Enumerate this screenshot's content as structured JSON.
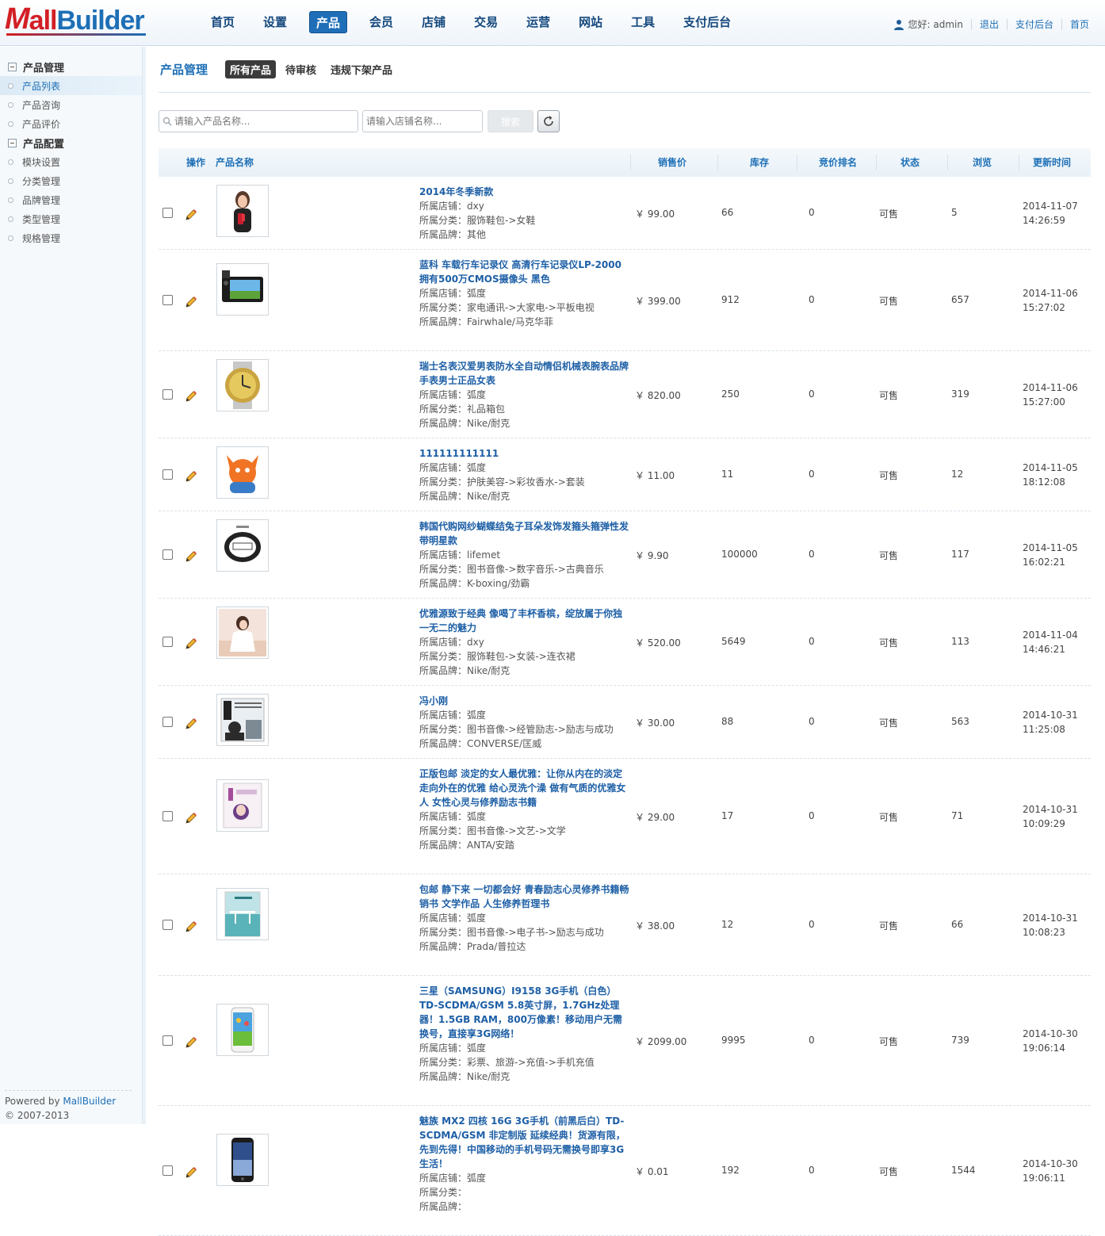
{
  "header": {
    "logo_m": "M",
    "logo_all": "all",
    "logo_builder": "Builder",
    "nav": [
      "首页",
      "设置",
      "产品",
      "会员",
      "店铺",
      "交易",
      "运营",
      "网站",
      "工具",
      "支付后台"
    ],
    "active_nav": 2,
    "greeting": "您好: admin",
    "logout": "退出",
    "pay_backend": "支付后台",
    "home": "首页"
  },
  "sidebar": {
    "groups": [
      {
        "title": "产品管理",
        "items": [
          "产品列表",
          "产品咨询",
          "产品评价"
        ]
      },
      {
        "title": "产品配置",
        "items": [
          "模块设置",
          "分类管理",
          "品牌管理",
          "类型管理",
          "规格管理"
        ]
      }
    ],
    "active_item": "产品列表",
    "powered_prefix": "Powered by ",
    "powered_link": "MallBuilder",
    "copyright": "© 2007-2013"
  },
  "main": {
    "title": "产品管理",
    "tabs": [
      "所有产品",
      "待审核",
      "违规下架产品"
    ],
    "active_tab": 0,
    "search": {
      "product_placeholder": "请输入产品名称...",
      "shop_placeholder": "请输入店铺名称...",
      "search_label": "搜索"
    },
    "columns": [
      "操作",
      "产品名称",
      "销售价",
      "库存",
      "竞价排名",
      "状态",
      "浏览",
      "更新时间"
    ],
    "labels": {
      "shop": "所属店铺：",
      "category": "所属分类：",
      "brand": "所属品牌："
    },
    "products": [
      {
        "name": "2014年冬季新款",
        "shop": "dxy",
        "category": "服饰鞋包->女鞋",
        "brand": "其他",
        "price": "￥ 99.00",
        "stock": "66",
        "rank": "0",
        "status": "可售",
        "views": "5",
        "date": "2014-11-07",
        "time": "14:26:59",
        "thumb": "woman-red"
      },
      {
        "name": "蓝科 车载行车记录仪 高清行车记录仪LP-2000 拥有500万CMOS摄像头 黑色",
        "shop": "弧度",
        "category": "家电通讯->大家电->平板电视",
        "brand": "Fairwhale/马克华菲",
        "price": "￥ 399.00",
        "stock": "912",
        "rank": "0",
        "status": "可售",
        "views": "657",
        "date": "2014-11-06",
        "time": "15:27:02",
        "thumb": "dashcam"
      },
      {
        "name": "瑞士名表汉爱男表防水全自动情侣机械表腕表品牌手表男士正品女表",
        "shop": "弧度",
        "category": "礼品箱包",
        "brand": "Nike/耐克",
        "price": "￥ 820.00",
        "stock": "250",
        "rank": "0",
        "status": "可售",
        "views": "319",
        "date": "2014-11-06",
        "time": "15:27:00",
        "thumb": "watch"
      },
      {
        "name": "111111111111",
        "shop": "弧度",
        "category": "护肤美容->彩妆香水->套装",
        "brand": "Nike/耐克",
        "price": "￥ 11.00",
        "stock": "11",
        "rank": "0",
        "status": "可售",
        "views": "12",
        "date": "2014-11-05",
        "time": "18:12:08",
        "thumb": "mascot"
      },
      {
        "name": "韩国代购网纱蝴蝶结兔子耳朵发饰发箍头箍弹性发带明星款",
        "shop": "lifemet",
        "category": "图书音像->数字音乐->古典音乐",
        "brand": "K-boxing/劲霸",
        "price": "￥ 9.90",
        "stock": "100000",
        "rank": "0",
        "status": "可售",
        "views": "117",
        "date": "2014-11-05",
        "time": "16:02:21",
        "thumb": "bracelet"
      },
      {
        "name": "优雅源致于经典 像喝了丰杯香槟，绽放属于你独一无二的魅力",
        "shop": "dxy",
        "category": "服饰鞋包->女装->连衣裙",
        "brand": "Nike/耐克",
        "price": "￥ 520.00",
        "stock": "5649",
        "rank": "0",
        "status": "可售",
        "views": "113",
        "date": "2014-11-04",
        "time": "14:46:21",
        "thumb": "woman-white"
      },
      {
        "name": "冯小刚",
        "shop": "弧度",
        "category": "图书音像->经管励志->励志与成功",
        "brand": "CONVERSE/匡威",
        "price": "￥ 30.00",
        "stock": "88",
        "rank": "0",
        "status": "可售",
        "views": "563",
        "date": "2014-10-31",
        "time": "11:25:08",
        "thumb": "book-portrait"
      },
      {
        "name": "正版包邮 淡定的女人最优雅：让你从内在的淡定走向外在的优雅 给心灵洗个澡 做有气质的优雅女人 女性心灵与修养励志书籍",
        "shop": "弧度",
        "category": "图书音像->文艺->文学",
        "brand": "ANTA/安踏",
        "price": "￥ 29.00",
        "stock": "17",
        "rank": "0",
        "status": "可售",
        "views": "71",
        "date": "2014-10-31",
        "time": "10:09:29",
        "thumb": "book-purple"
      },
      {
        "name": "包邮 静下来 一切都会好 青春励志心灵修养书籍畅销书 文学作品 人生修养哲理书",
        "shop": "弧度",
        "category": "图书音像->电子书->励志与成功",
        "brand": "Prada/普拉达",
        "price": "￥ 38.00",
        "stock": "12",
        "rank": "0",
        "status": "可售",
        "views": "66",
        "date": "2014-10-31",
        "time": "10:08:23",
        "thumb": "book-teal"
      },
      {
        "name": "三星（SAMSUNG）I9158 3G手机（白色） TD-SCDMA/GSM 5.8英寸屏，1.7GHz处理器！1.5GB RAM，800万像素！移动用户无需换号，直接享3G网络！",
        "shop": "弧度",
        "category": "彩票、旅游->充值->手机充值",
        "brand": "Nike/耐克",
        "price": "￥ 2099.00",
        "stock": "9995",
        "rank": "0",
        "status": "可售",
        "views": "739",
        "date": "2014-10-30",
        "time": "19:06:14",
        "thumb": "phone-white"
      },
      {
        "name": "魅族 MX2 四核 16G 3G手机（前黑后白）TD-SCDMA/GSM 非定制版 延续经典！货源有限，先到先得！中国移动的手机号码无需换号即享3G生活！",
        "shop": "弧度",
        "category": "",
        "brand": "",
        "price": "￥ 0.01",
        "stock": "192",
        "rank": "0",
        "status": "可售",
        "views": "1544",
        "date": "2014-10-30",
        "time": "19:06:11",
        "thumb": "phone-black"
      }
    ]
  }
}
